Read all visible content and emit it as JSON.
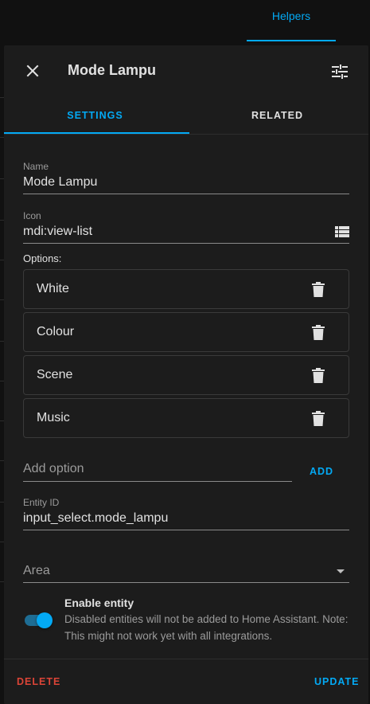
{
  "background": {
    "helpers_tab": "Helpers"
  },
  "dialog": {
    "title": "Mode Lampu",
    "icons": {
      "close": "close-icon",
      "settings": "tune-icon"
    },
    "tabs": [
      {
        "label": "SETTINGS",
        "active": true
      },
      {
        "label": "RELATED",
        "active": false
      }
    ],
    "name": {
      "label": "Name",
      "value": "Mode Lampu"
    },
    "icon_field": {
      "label": "Icon",
      "value": "mdi:view-list",
      "icon": "view-list-icon"
    },
    "options_label": "Options:",
    "options": [
      {
        "label": "White"
      },
      {
        "label": "Colour"
      },
      {
        "label": "Scene"
      },
      {
        "label": "Music"
      }
    ],
    "add_option": {
      "placeholder": "Add option",
      "button": "ADD"
    },
    "entity_id": {
      "label": "Entity ID",
      "value": "input_select.mode_lampu"
    },
    "area": {
      "placeholder": "Area"
    },
    "enable_entity": {
      "title": "Enable entity",
      "description": "Disabled entities will not be added to Home Assistant. Note: This might not work yet with all integrations.",
      "enabled": true
    },
    "footer": {
      "delete": "DELETE",
      "update": "UPDATE"
    }
  },
  "colors": {
    "accent": "#03a9f4",
    "danger": "#db4437",
    "surface": "#1c1c1c"
  }
}
